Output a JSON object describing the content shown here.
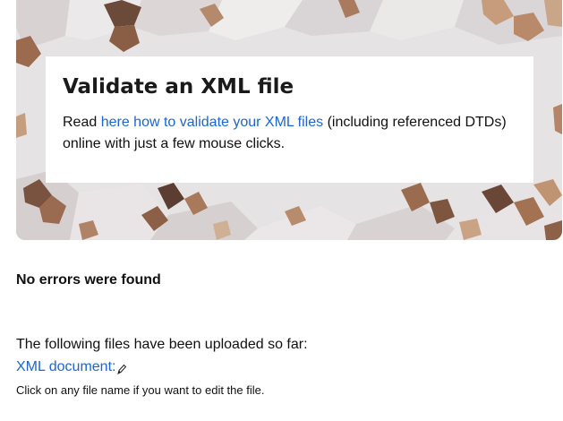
{
  "hero": {
    "title": "Validate an XML file",
    "text_before_link": "Read ",
    "link_text": "here how to validate your XML files",
    "text_after_link": " (including referenced DTDs) online with just a few mouse clicks."
  },
  "status": {
    "message": "No errors were found"
  },
  "uploads": {
    "intro": "The following files have been uploaded so far:",
    "files": [
      {
        "label": "XML document:",
        "icon": "pencil-icon"
      }
    ],
    "hint": "Click on any file name if you want to edit the file."
  },
  "colors": {
    "link": "#1a66d6",
    "text": "#111111",
    "hero_background": "#e3e0e0"
  }
}
